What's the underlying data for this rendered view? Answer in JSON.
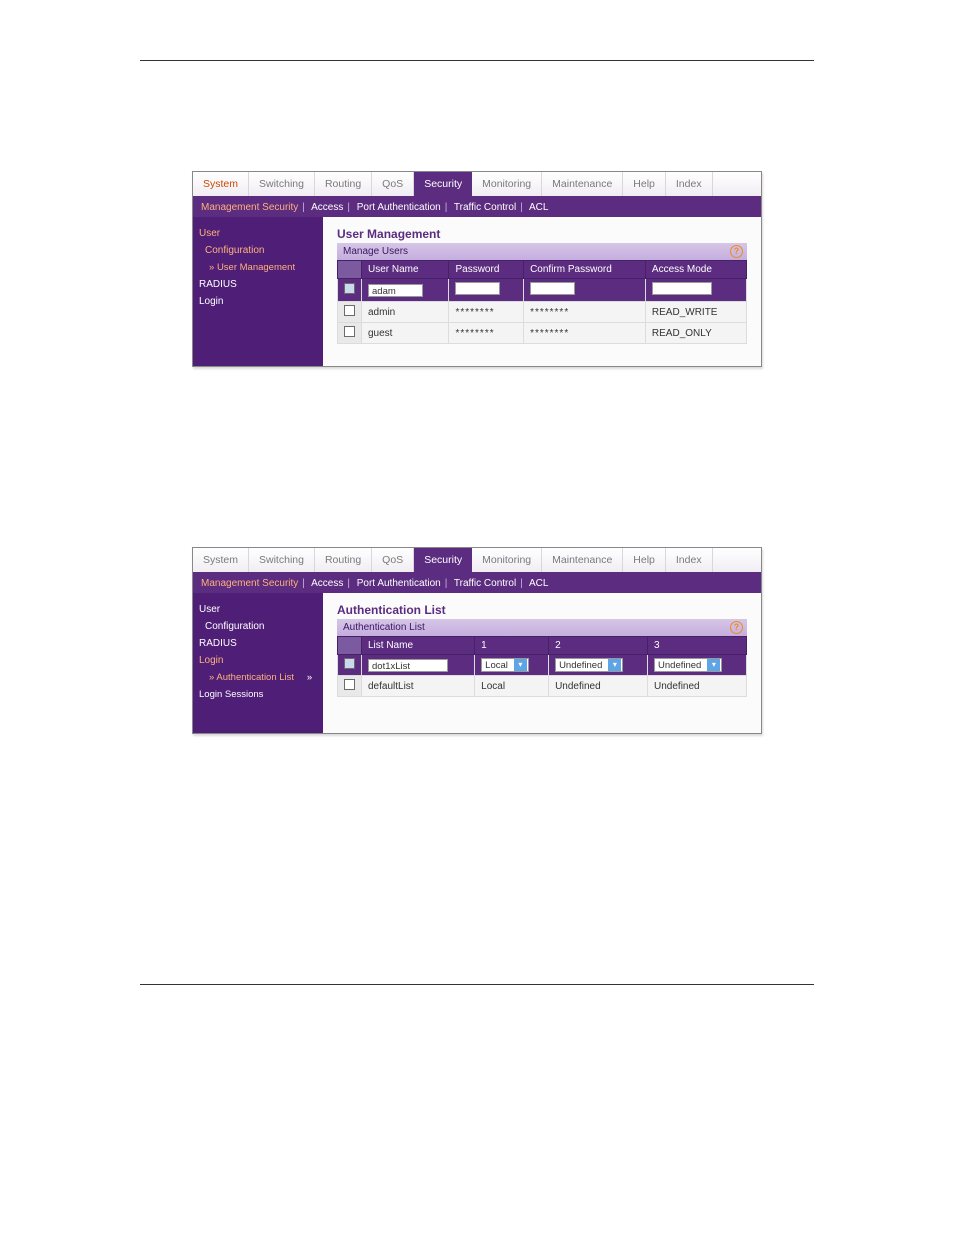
{
  "tabs": {
    "system": "System",
    "switching": "Switching",
    "routing": "Routing",
    "qos": "QoS",
    "security": "Security",
    "monitoring": "Monitoring",
    "maintenance": "Maintenance",
    "help": "Help",
    "index": "Index"
  },
  "subtabs": {
    "mgmt": "Management Security",
    "access": "Access",
    "portauth": "Port Authentication",
    "traffic": "Traffic Control",
    "acl": "ACL"
  },
  "shot1": {
    "side": {
      "user_conf": "User Configuration",
      "user_conf_short": "User",
      "user_mgmt": "User Management",
      "radius": "RADIUS",
      "login": "Login"
    },
    "title": "User Management",
    "panel": "Manage Users",
    "th": {
      "un": "User Name",
      "pw": "Password",
      "cpw": "Confirm Password",
      "am": "Access Mode"
    },
    "row_in": {
      "un": "adam"
    },
    "rows": [
      {
        "un": "admin",
        "pw": "********",
        "cpw": "********",
        "am": "READ_WRITE"
      },
      {
        "un": "guest",
        "pw": "********",
        "cpw": "********",
        "am": "READ_ONLY"
      }
    ]
  },
  "shot2": {
    "side": {
      "user_conf": "User Configuration",
      "user_conf_short": "User",
      "radius": "RADIUS",
      "login": "Login",
      "auth_list": "Authentication List",
      "login_sess": "Login Sessions"
    },
    "title": "Authentication List",
    "panel": "Authentication List",
    "th": {
      "ln": "List Name",
      "c1": "1",
      "c2": "2",
      "c3": "3"
    },
    "row_in": {
      "ln": "dot1xList",
      "c1": "Local",
      "c2": "Undefined",
      "c3": "Undefined"
    },
    "rows": [
      {
        "ln": "defaultList",
        "c1": "Local",
        "c2": "Undefined",
        "c3": "Undefined"
      }
    ]
  }
}
